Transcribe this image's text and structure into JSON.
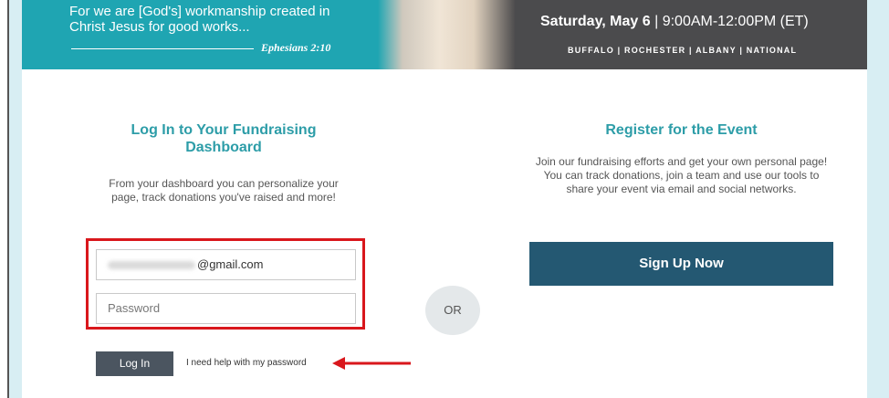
{
  "banner": {
    "verse": "For we are [God's] workmanship created in Christ Jesus for good works...",
    "verse_reference": "Ephesians 2:10",
    "event_date": "Saturday, May 6",
    "event_separator": "|",
    "event_time": "9:00AM-12:00PM (ET)",
    "event_locations": "BUFFALO | ROCHESTER | ALBANY | NATIONAL"
  },
  "login": {
    "title": "Log In to Your Fundraising Dashboard",
    "description": "From your dashboard you can personalize your page, track donations you've raised and more!",
    "email_value": "@gmail.com",
    "password_placeholder": "Password",
    "login_button": "Log In",
    "help_link": "I need help with my password"
  },
  "divider": {
    "or_label": "OR"
  },
  "register": {
    "title": "Register for the Event",
    "description": "Join our fundraising efforts and get your own personal page! You can track donations, join a team and use our tools to share your event via email and social networks.",
    "signup_button": "Sign Up Now"
  },
  "colors": {
    "banner_teal": "#1fa5b2",
    "banner_dark": "#4b4b4d",
    "heading_teal": "#2d9da8",
    "signup_blue": "#245872",
    "login_gray": "#4b5560",
    "annotation_red": "#d9171c"
  }
}
